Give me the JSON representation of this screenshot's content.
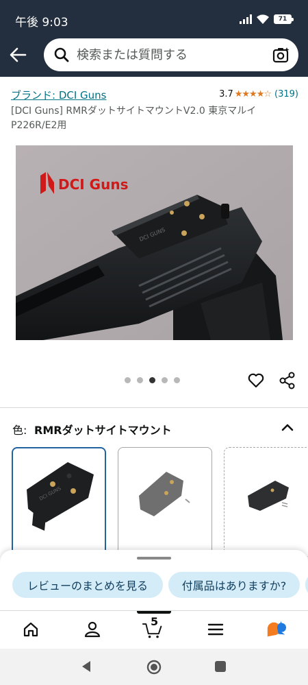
{
  "status_bar": {
    "time": "午後 9:03",
    "battery": "71"
  },
  "search": {
    "placeholder": "検索または質問する"
  },
  "product": {
    "brand": "ブランド: DCI Guns",
    "rating": "3.7",
    "stars": "★★★★☆",
    "rating_count": "(319)",
    "title": "[DCI Guns] RMRダットサイトマウントV2.0 東京マルイ P226R/E2用"
  },
  "gallery": {
    "image_logo_text": "DCI Guns",
    "dot_count": 5,
    "active_dot": 3
  },
  "variation": {
    "label": "色:",
    "value": "RMRダットサイトマウント"
  },
  "chips": [
    {
      "label": "レビューのまとめを見る"
    },
    {
      "label": "付属品はありますか?"
    }
  ],
  "bottom_nav": {
    "cart_count": "5"
  },
  "colors": {
    "header_bg": "#232f3e",
    "link": "#007185",
    "star": "#de7921",
    "chip_bg": "#d4ecf7",
    "selected_border": "#2162a1"
  }
}
